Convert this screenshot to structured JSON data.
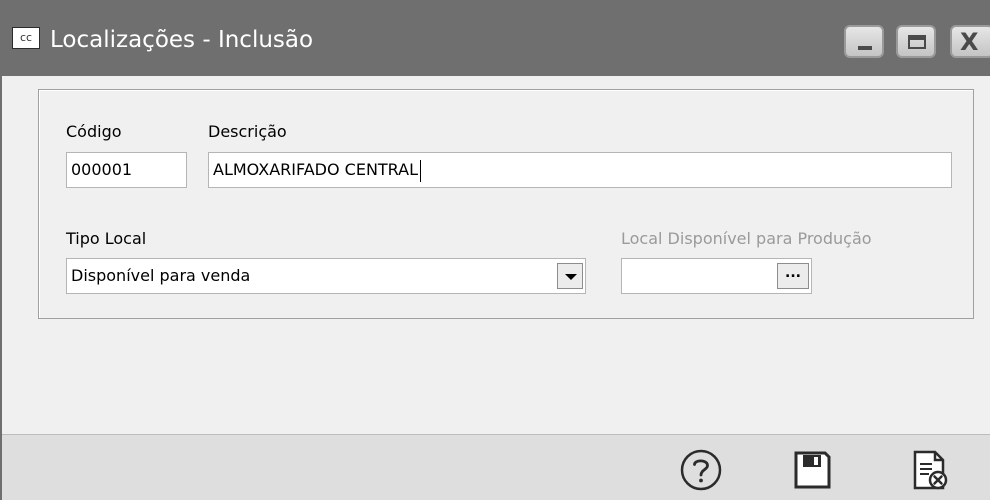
{
  "window": {
    "icon_text": "cc",
    "title": "Localizações - Inclusão"
  },
  "form": {
    "codigo_label": "Código",
    "codigo_value": "000001",
    "descricao_label": "Descrição",
    "descricao_value": "ALMOXARIFADO CENTRAL",
    "tipo_local_label": "Tipo Local",
    "tipo_local_value": "Disponível para venda",
    "local_producao_label": "Local Disponível para Produção",
    "local_producao_value": "",
    "ellipsis": "..."
  },
  "icons": {
    "help": "help-icon",
    "save": "save-icon",
    "cancel": "cancel-document-icon"
  },
  "colors": {
    "titlebar": "#6f6f6f",
    "body": "#f0f0f0",
    "footer": "#dedede"
  }
}
